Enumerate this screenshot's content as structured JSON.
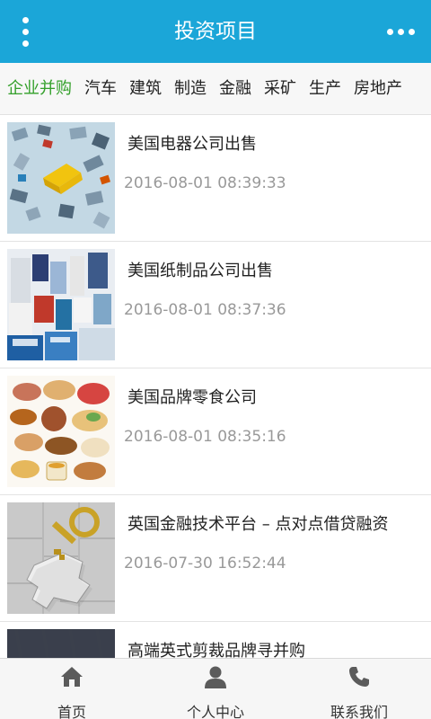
{
  "header": {
    "title": "投资项目",
    "menu_icon": "vertical-dots-icon",
    "more_icon": "horizontal-dots-icon",
    "background_color": "#1ba6d8"
  },
  "tabs": [
    {
      "label": "企业并购",
      "active": true
    },
    {
      "label": "汽车",
      "active": false
    },
    {
      "label": "建筑",
      "active": false
    },
    {
      "label": "制造",
      "active": false
    },
    {
      "label": "金融",
      "active": false
    },
    {
      "label": "采矿",
      "active": false
    },
    {
      "label": "生产",
      "active": false
    },
    {
      "label": "房地产",
      "active": false
    }
  ],
  "active_tab_color": "#34a02b",
  "articles": [
    {
      "title": "美国电器公司出售",
      "time": "2016-08-01 08:39:33",
      "image": "electronics-collage"
    },
    {
      "title": "美国纸制品公司出售",
      "time": "2016-08-01 08:37:36",
      "image": "paper-products"
    },
    {
      "title": "美国品牌零食公司",
      "time": "2016-08-01 08:35:16",
      "image": "snack-foods"
    },
    {
      "title": "英国金融技术平台 – 点对点借贷融资",
      "time": "2016-07-30 16:52:44",
      "image": "key-in-puzzle"
    },
    {
      "title": "高端英式剪裁品牌寻并购",
      "time": "",
      "image": "fabric-texture"
    }
  ],
  "bottom_nav": [
    {
      "label": "首页",
      "icon": "home-icon"
    },
    {
      "label": "个人中心",
      "icon": "user-icon"
    },
    {
      "label": "联系我们",
      "icon": "phone-icon"
    }
  ]
}
